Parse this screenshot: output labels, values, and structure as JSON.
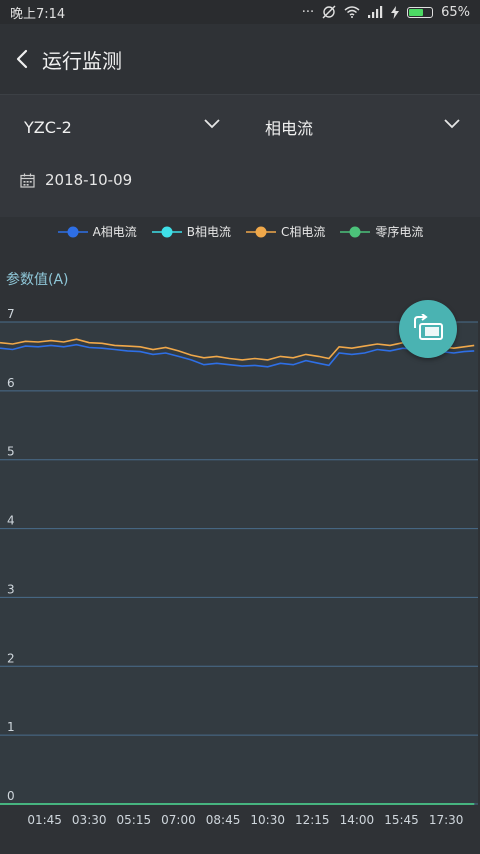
{
  "status_bar": {
    "time": "晚上7:14",
    "dots": "···",
    "battery": "65%",
    "battery_level": 0.65
  },
  "header": {
    "title": "运行监测"
  },
  "filters": {
    "device": "YZC-2",
    "metric": "相电流",
    "date": "2018-10-09"
  },
  "chart_data": {
    "type": "line",
    "ylabel": "参数值(A)",
    "ylim": [
      0,
      7
    ],
    "yticks": [
      0,
      1,
      2,
      3,
      4,
      5,
      6,
      7
    ],
    "grid": true,
    "legend_position": "top-center",
    "x_tick_labels": [
      "01:45",
      "03:30",
      "05:15",
      "07:00",
      "08:45",
      "10:30",
      "12:15",
      "14:00",
      "15:45",
      "17:30"
    ],
    "x_tick_hours": [
      1.75,
      3.5,
      5.25,
      7.0,
      8.75,
      10.5,
      12.25,
      14.0,
      15.75,
      17.5
    ],
    "x_range_hours": [
      0,
      18.75
    ],
    "series": [
      {
        "name": "A相电流",
        "color": "#2e6fe6",
        "x": [
          0,
          0.5,
          1,
          1.5,
          2,
          2.5,
          3,
          3.5,
          4,
          4.5,
          5,
          5.5,
          6,
          6.5,
          7,
          7.5,
          8,
          8.5,
          9,
          9.5,
          10,
          10.5,
          11,
          11.5,
          12,
          12.5,
          12.9,
          13.3,
          13.8,
          14.3,
          14.8,
          15.3,
          15.8,
          16.3,
          16.8,
          17.3,
          17.8,
          18.2,
          18.6
        ],
        "y": [
          6.62,
          6.6,
          6.65,
          6.64,
          6.66,
          6.64,
          6.67,
          6.63,
          6.62,
          6.6,
          6.58,
          6.57,
          6.53,
          6.55,
          6.5,
          6.45,
          6.38,
          6.4,
          6.38,
          6.36,
          6.37,
          6.35,
          6.4,
          6.38,
          6.44,
          6.4,
          6.37,
          6.55,
          6.53,
          6.55,
          6.6,
          6.58,
          6.62,
          6.6,
          6.58,
          6.57,
          6.55,
          6.57,
          6.58
        ]
      },
      {
        "name": "B相电流",
        "color": "#3fe0e8",
        "x": [
          0,
          18.6
        ],
        "y": [
          0,
          0
        ]
      },
      {
        "name": "C相电流",
        "color": "#f0a84a",
        "x": [
          0,
          0.5,
          1,
          1.5,
          2,
          2.5,
          3,
          3.5,
          4,
          4.5,
          5,
          5.5,
          6,
          6.5,
          7,
          7.5,
          8,
          8.5,
          9,
          9.5,
          10,
          10.5,
          11,
          11.5,
          12,
          12.5,
          12.9,
          13.3,
          13.8,
          14.3,
          14.8,
          15.3,
          15.8,
          16.3,
          16.8,
          17.3,
          17.8,
          18.2,
          18.6
        ],
        "y": [
          6.7,
          6.68,
          6.72,
          6.71,
          6.73,
          6.71,
          6.75,
          6.7,
          6.69,
          6.66,
          6.65,
          6.64,
          6.6,
          6.63,
          6.58,
          6.52,
          6.48,
          6.5,
          6.47,
          6.45,
          6.47,
          6.45,
          6.5,
          6.48,
          6.53,
          6.5,
          6.47,
          6.64,
          6.62,
          6.65,
          6.68,
          6.66,
          6.7,
          6.68,
          6.66,
          6.64,
          6.62,
          6.64,
          6.66
        ]
      },
      {
        "name": "零序电流",
        "color": "#4cc27a",
        "x": [
          0,
          18.6
        ],
        "y": [
          0,
          0
        ]
      }
    ]
  },
  "colors": {
    "background": "#2f3236",
    "panel": "#34373c",
    "grid": "#4a6d8c",
    "plot_bg": "#333b41",
    "fab": "#4ab3b2"
  },
  "icons": {
    "back": "chevron-left-icon",
    "dropdown": "chevron-down-icon",
    "calendar": "calendar-icon",
    "fab": "rotate-screen-icon"
  }
}
